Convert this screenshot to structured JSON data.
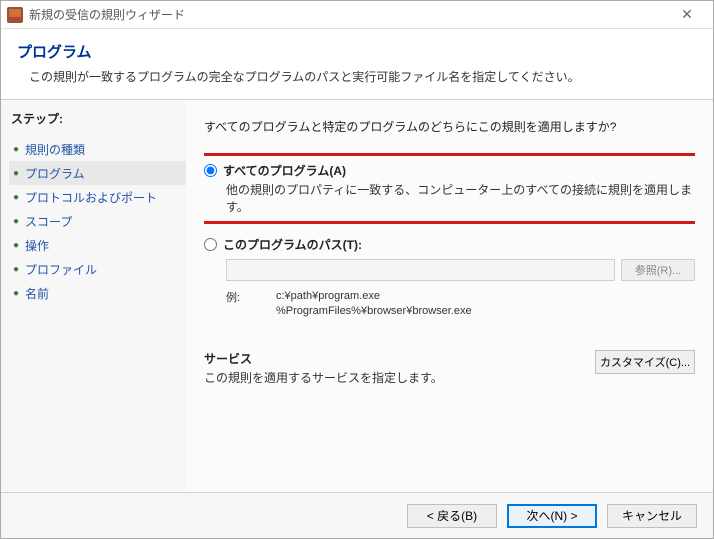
{
  "titlebar": {
    "text": "新規の受信の規則ウィザード"
  },
  "header": {
    "title": "プログラム",
    "subtitle": "この規則が一致するプログラムの完全なプログラムのパスと実行可能ファイル名を指定してください。"
  },
  "sidebar": {
    "heading": "ステップ:",
    "items": [
      {
        "label": "規則の種類"
      },
      {
        "label": "プログラム"
      },
      {
        "label": "プロトコルおよびポート"
      },
      {
        "label": "スコープ"
      },
      {
        "label": "操作"
      },
      {
        "label": "プロファイル"
      },
      {
        "label": "名前"
      }
    ],
    "active_index": 1
  },
  "main": {
    "question": "すべてのプログラムと特定のプログラムのどちらにこの規則を適用しますか?",
    "opt_all": {
      "label": "すべてのプログラム(A)",
      "desc": "他の規則のプロパティに一致する、コンピューター上のすべての接続に規則を適用します。"
    },
    "opt_path": {
      "label": "このプログラムのパス(T):",
      "browse": "参照(R)...",
      "example_label": "例:",
      "example1": "c:¥path¥program.exe",
      "example2": "%ProgramFiles%¥browser¥browser.exe"
    },
    "service": {
      "title": "サービス",
      "desc": "この規則を適用するサービスを指定します。",
      "customize": "カスタマイズ(C)..."
    }
  },
  "footer": {
    "back": "< 戻る(B)",
    "next": "次へ(N) >",
    "cancel": "キャンセル"
  }
}
